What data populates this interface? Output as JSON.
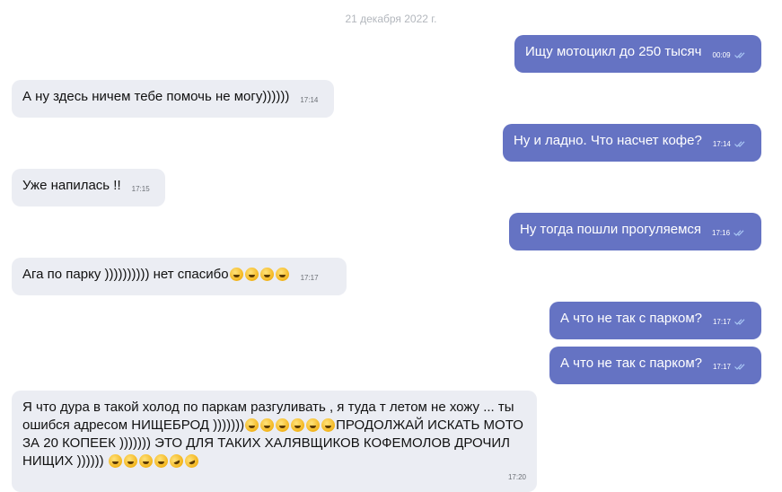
{
  "chat": {
    "date": "21 декабря 2022 г.",
    "messages": [
      {
        "dir": "out",
        "text": "Ищу мотоцикл до 250 тысяч",
        "time": "00:09"
      },
      {
        "dir": "in",
        "text": "А ну здесь ничем тебе помочь не могу))))))",
        "time": "17:14"
      },
      {
        "dir": "out",
        "text": "Ну и ладно. Что насчет кофе?",
        "time": "17:14"
      },
      {
        "dir": "in",
        "text": "Уже напилась !!",
        "time": "17:15"
      },
      {
        "dir": "out",
        "text": "Ну тогда пошли прогуляемся",
        "time": "17:16"
      },
      {
        "dir": "in",
        "text": "Ага по парку )))))))))) нет спасибо",
        "emoji": [
          "grinning-sweat-emoji",
          "grinning-sweat-emoji",
          "grinning-sweat-emoji",
          "grinning-sweat-emoji"
        ],
        "time": "17:17"
      },
      {
        "dir": "out",
        "text": "А что не так с парком?",
        "time": "17:17"
      },
      {
        "dir": "out",
        "text": "А что не так с парком?",
        "time": "17:17"
      },
      {
        "dir": "in",
        "text": "Я что дура в такой холод по паркам разгуливать , я туда т летом не хожу ... ты ошибся адресом НИЩЕБРОД )))))))",
        "emoji": [
          "grinning-sweat-emoji",
          "grinning-sweat-emoji",
          "grinning-sweat-emoji",
          "grinning-sweat-emoji",
          "grinning-sweat-emoji",
          "grinning-sweat-emoji"
        ],
        "text2": "ПРОДОЛЖАЙ ИСКАТЬ МОТО ЗА 20 КОПЕЕК ))))))) ЭТО ДЛЯ ТАКИХ ХАЛЯВЩИКОВ КОФЕМОЛОВ ДРОЧИЛ НИЩИХ ))))))",
        "emoji2": [
          "grinning-sweat-emoji",
          "grinning-sweat-emoji",
          "grinning-sweat-emoji",
          "grinning-sweat-emoji",
          "rofl-emoji",
          "rofl-emoji"
        ],
        "time": "17:20"
      }
    ]
  },
  "colors": {
    "outgoing_bubble": "#6573c3",
    "incoming_bubble": "#ebedf3",
    "read_check": "#a9c7f5"
  },
  "icons": {
    "read_status": "double-check-icon"
  }
}
